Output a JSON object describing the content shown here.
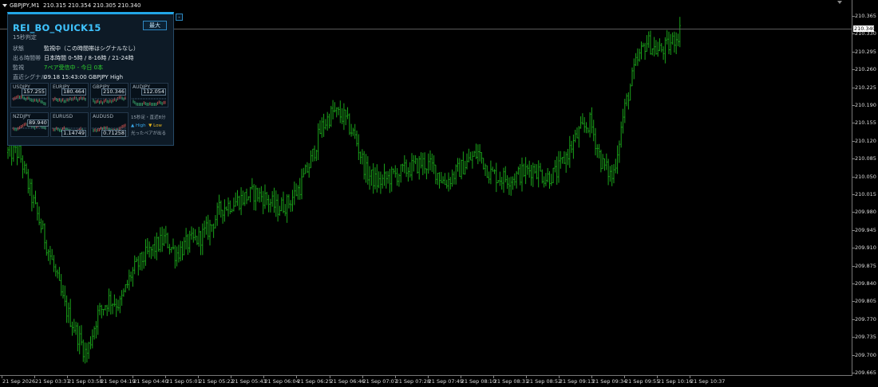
{
  "header": {
    "symbol_tf": "GBPJPY,M1",
    "ohlc": "210.315 210.354 210.305 210.340"
  },
  "price_axis": {
    "labels": [
      "210.365",
      "210.330",
      "210.295",
      "210.260",
      "210.225",
      "210.190",
      "210.155",
      "210.120",
      "210.085",
      "210.050",
      "210.015",
      "209.980",
      "209.945",
      "209.910",
      "209.875",
      "209.840",
      "209.805",
      "209.770",
      "209.735",
      "209.700",
      "209.665"
    ],
    "current_price": "210.340"
  },
  "time_axis": {
    "labels": [
      "21 Sep 2026",
      "21 Sep 03:37",
      "21 Sep 03:58",
      "21 Sep 04:19",
      "21 Sep 04:40",
      "21 Sep 05:01",
      "21 Sep 05:22",
      "21 Sep 05:43",
      "21 Sep 06:04",
      "21 Sep 06:25",
      "21 Sep 06:46",
      "21 Sep 07:07",
      "21 Sep 07:28",
      "21 Sep 07:49",
      "21 Sep 08:10",
      "21 Sep 08:31",
      "21 Sep 08:52",
      "21 Sep 09:13",
      "21 Sep 09:34",
      "21 Sep 09:55",
      "21 Sep 10:16",
      "21 Sep 10:37"
    ]
  },
  "panel": {
    "collapse_label": "-",
    "title": "REI_BO_QUICK15",
    "subtitle": "15秒判定",
    "max_button": "最大",
    "rows": [
      {
        "key": "状態",
        "value": "監視中（この時間帯はシグナルなし）"
      },
      {
        "key": "出る時間帯",
        "value": "日本時間 0-5時 / 8-16時 / 21-24時"
      },
      {
        "key": "監視",
        "value": "7ペア受信中 - 今日 0本"
      },
      {
        "key": "直近シグナル",
        "value": "09.18 15:43:00   GBPJPY   High"
      }
    ],
    "pairs": [
      {
        "name": "USDJPY",
        "price": "157.255"
      },
      {
        "name": "EURJPY",
        "price": "180.464"
      },
      {
        "name": "GBPJPY",
        "price": "210.346"
      },
      {
        "name": "AUDJPY",
        "price": "112.054"
      },
      {
        "name": "NZDJPY",
        "price": "89.940"
      },
      {
        "name": "EURUSD",
        "price": "1.14749"
      },
      {
        "name": "AUDUSD",
        "price": "0.71258"
      }
    ],
    "legend": {
      "line1": "15秒足・直近8分",
      "high": "▲ High",
      "low": "▼ Low",
      "line3": "光ったペアが出る"
    }
  },
  "colors": {
    "bars": "#1aa31a",
    "accent": "#22a6e6",
    "title": "#3fc4ff",
    "high": "#38a6e8",
    "low": "#e8b71c"
  },
  "chart_data": {
    "type": "ohlc",
    "symbol": "GBPJPY",
    "timeframe": "M1",
    "ylim": [
      209.665,
      210.37
    ],
    "x": [
      "03:30",
      "03:37",
      "03:42",
      "03:50",
      "03:58",
      "04:05",
      "04:12",
      "04:19",
      "04:25",
      "04:32",
      "04:40",
      "04:47",
      "04:54",
      "05:01",
      "05:08",
      "05:15",
      "05:22",
      "05:29",
      "05:36",
      "05:43",
      "05:50",
      "05:57",
      "06:04",
      "06:11",
      "06:18",
      "06:25",
      "06:32",
      "06:39",
      "06:46",
      "06:50",
      "06:55",
      "07:00",
      "07:07",
      "07:14",
      "07:21",
      "07:28",
      "07:35",
      "07:42",
      "07:49",
      "07:56",
      "08:03",
      "08:10",
      "08:17",
      "08:24",
      "08:31",
      "08:38",
      "08:45",
      "08:52",
      "08:59",
      "09:06",
      "09:13",
      "09:20",
      "09:27",
      "09:34",
      "09:41",
      "09:48",
      "09:55",
      "10:00",
      "10:05",
      "10:10",
      "10:14"
    ],
    "close": [
      210.1,
      210.1,
      210.02,
      209.95,
      209.88,
      209.8,
      209.75,
      209.7,
      209.78,
      209.81,
      209.8,
      209.86,
      209.89,
      209.91,
      209.93,
      209.9,
      209.92,
      209.93,
      209.95,
      209.99,
      210.0,
      210.01,
      210.02,
      210.01,
      209.99,
      210.0,
      210.03,
      210.08,
      210.15,
      210.18,
      210.17,
      210.13,
      210.06,
      210.04,
      210.05,
      210.06,
      210.07,
      210.08,
      210.07,
      210.04,
      210.06,
      210.08,
      210.1,
      210.06,
      210.05,
      210.05,
      210.06,
      210.07,
      210.05,
      210.06,
      210.1,
      210.14,
      210.16,
      210.08,
      210.05,
      210.18,
      210.27,
      210.32,
      210.3,
      210.31,
      210.34
    ]
  }
}
